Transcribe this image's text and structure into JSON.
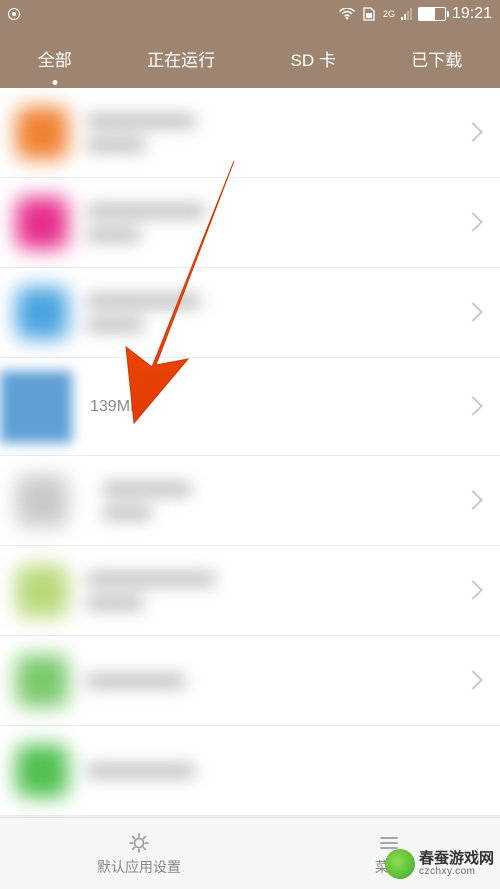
{
  "status": {
    "network_badge": "2G",
    "time": "19:21"
  },
  "tabs": [
    {
      "label": "全部",
      "active": true
    },
    {
      "label": "正在运行",
      "active": false
    },
    {
      "label": "SD 卡",
      "active": false
    },
    {
      "label": "已下载",
      "active": false
    }
  ],
  "apps": [
    {
      "size_label": "",
      "icon_color": "#f08030"
    },
    {
      "size_label": "",
      "icon_color": "#e62e8b"
    },
    {
      "size_label": "",
      "icon_color": "#4aa3e0"
    },
    {
      "size_label": "139MB",
      "icon_color": "#5f9fd6"
    },
    {
      "size_label": "",
      "icon_color": "#c9c9c9"
    },
    {
      "size_label": "",
      "icon_color": "#b8d97a"
    },
    {
      "size_label": "",
      "icon_color": "#7ac96b"
    },
    {
      "size_label": "",
      "icon_color": "#4fc04f"
    }
  ],
  "bottom": {
    "left_label": "默认应用设置",
    "right_label": "菜单"
  },
  "watermark": {
    "title": "春蚕游戏网",
    "url": "czchxy.com"
  }
}
